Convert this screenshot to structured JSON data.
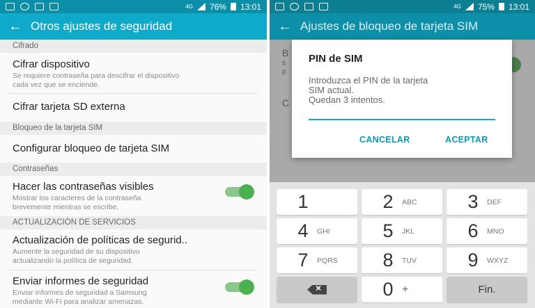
{
  "left": {
    "status": {
      "battery": "76%",
      "time": "13:01",
      "network": "4G"
    },
    "title": "Otros ajustes de seguridad",
    "sections": [
      {
        "header": "Cifrado"
      },
      {
        "title": "Cifrar dispositivo",
        "sub": "Se requiere contraseña para descifrar el dispositivo\ncada vez que se enciende."
      },
      {
        "title": "Cifrar tarjeta SD externa"
      },
      {
        "header": "Bloqueo de la tarjeta SIM"
      },
      {
        "title": "Configurar bloqueo de tarjeta SIM"
      },
      {
        "header": "Contraseñas"
      },
      {
        "title": "Hacer las contraseñas visibles",
        "sub": "Mostrar los caracteres de la contraseña\nbrevemente mientras se escribe.",
        "toggle": true
      },
      {
        "header": "ACTUALIZACIÓN DE SERVICIOS"
      },
      {
        "title": "Actualización de políticas de segurid..",
        "sub": "Aumente la seguridad de su dispositivo\nactualizando la política de seguridad."
      },
      {
        "title": "Enviar informes de seguridad",
        "sub": "Enviar informes de seguridad a Samsung\nmediante Wi-Fi para analizar amenazas.",
        "toggle": true
      }
    ]
  },
  "right": {
    "status": {
      "battery": "75%",
      "time": "13:01",
      "network": "4G"
    },
    "title": "Ajustes de bloqueo de tarjeta SIM",
    "behind": {
      "item1": "B",
      "item1b": "ti",
      "item1c": "p",
      "item2": "C"
    },
    "dialog": {
      "title": "PIN de SIM",
      "message": "Introduzca el PIN de la tarjeta\nSIM actual.\nQuedan 3 intentos.",
      "cancel": "CANCELAR",
      "accept": "ACEPTAR"
    },
    "keypad": {
      "keys": [
        {
          "num": "1",
          "letters": ""
        },
        {
          "num": "2",
          "letters": "ABC"
        },
        {
          "num": "3",
          "letters": "DEF"
        },
        {
          "num": "4",
          "letters": "GHI"
        },
        {
          "num": "5",
          "letters": "JKL"
        },
        {
          "num": "6",
          "letters": "MNO"
        },
        {
          "num": "7",
          "letters": "PQRS"
        },
        {
          "num": "8",
          "letters": "TUV"
        },
        {
          "num": "9",
          "letters": "WXYZ"
        },
        {
          "num": "0",
          "letters": "+"
        }
      ],
      "done": "Fin."
    }
  }
}
